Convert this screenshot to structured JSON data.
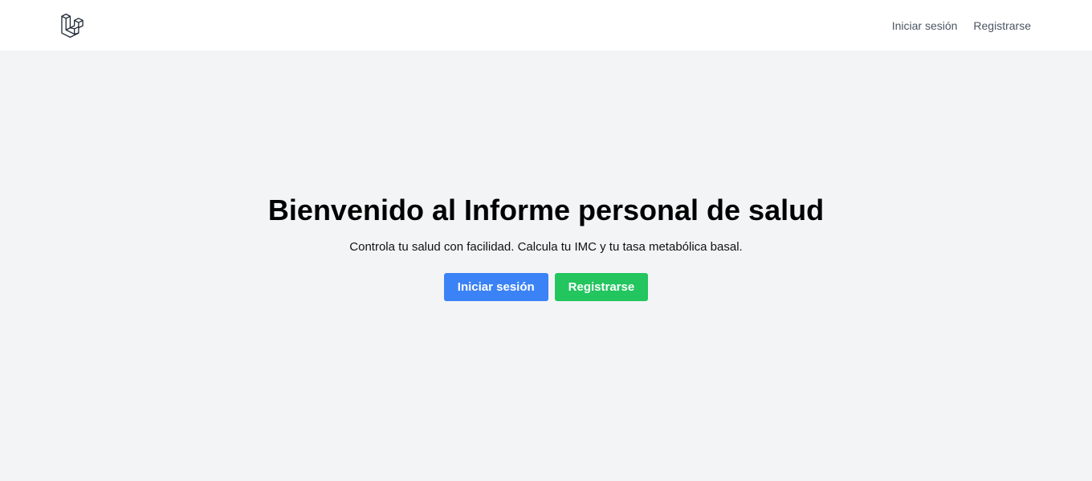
{
  "nav": {
    "logo_icon": "laravel-logo-icon",
    "links": [
      {
        "label": "Iniciar sesión"
      },
      {
        "label": "Registrarse"
      }
    ]
  },
  "hero": {
    "title": "Bienvenido al Informe personal de salud",
    "subtitle": "Controla tu salud con facilidad. Calcula tu IMC y tu tasa metabólica basal.",
    "buttons": [
      {
        "label": "Iniciar sesión",
        "color": "#3b82f6"
      },
      {
        "label": "Registrarse",
        "color": "#22c55e"
      }
    ]
  },
  "colors": {
    "background": "#f3f4f6",
    "navbar": "#ffffff",
    "nav_text": "#4b5563"
  }
}
